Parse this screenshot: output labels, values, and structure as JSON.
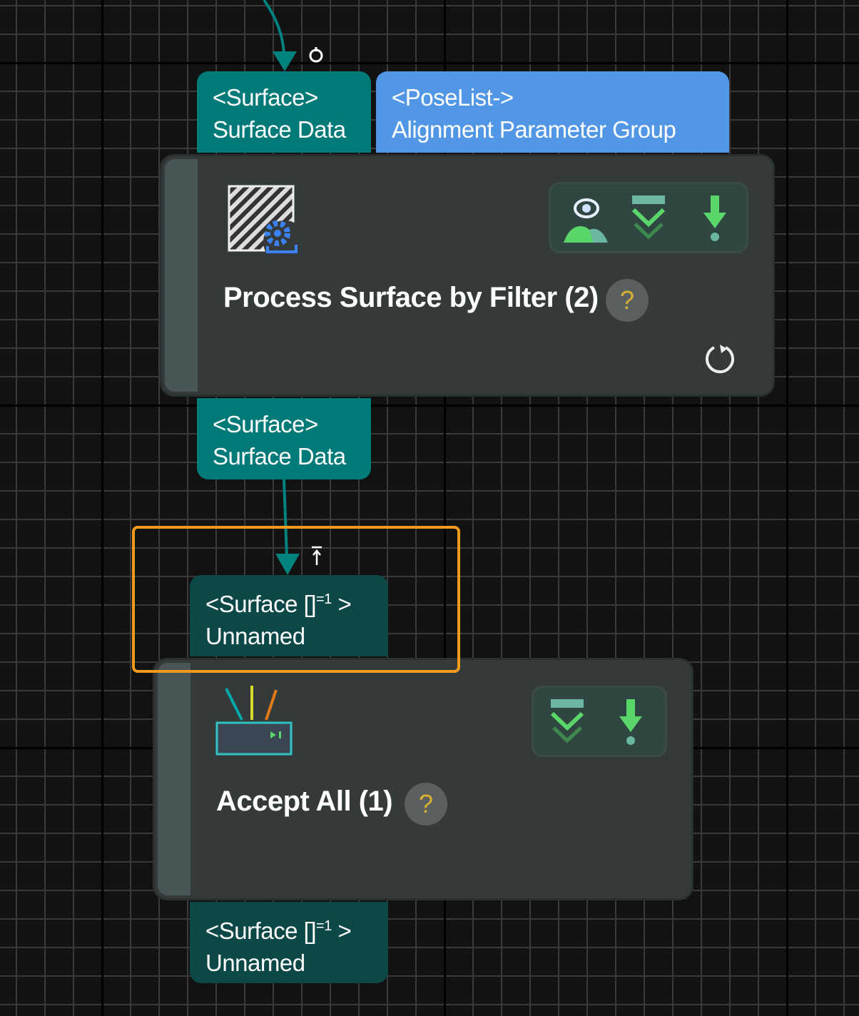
{
  "node1": {
    "title": "Process Surface by Filter (2)",
    "help": "?",
    "inputs": [
      {
        "type": "<Surface>",
        "name": "Surface Data",
        "color": "#007a78"
      },
      {
        "type": "<PoseList->",
        "name": "Alignment Parameter Group",
        "color": "#5297e6"
      }
    ],
    "output": {
      "type": "<Surface>",
      "name": "Surface Data"
    },
    "actions": [
      "visualize-icon",
      "skip-icon",
      "breakpoint-icon"
    ]
  },
  "node2": {
    "title": "Accept All (1)",
    "help": "?",
    "input": {
      "type": "<Surface []",
      "sup": "=1",
      "close": " >",
      "name": "Unnamed"
    },
    "output": {
      "type": "<Surface []",
      "sup": "=1",
      "close": " >",
      "name": "Unnamed"
    },
    "actions": [
      "skip-icon",
      "breakpoint-icon"
    ]
  },
  "colors": {
    "connection": "#00827f",
    "selection": "#f29a1f"
  }
}
